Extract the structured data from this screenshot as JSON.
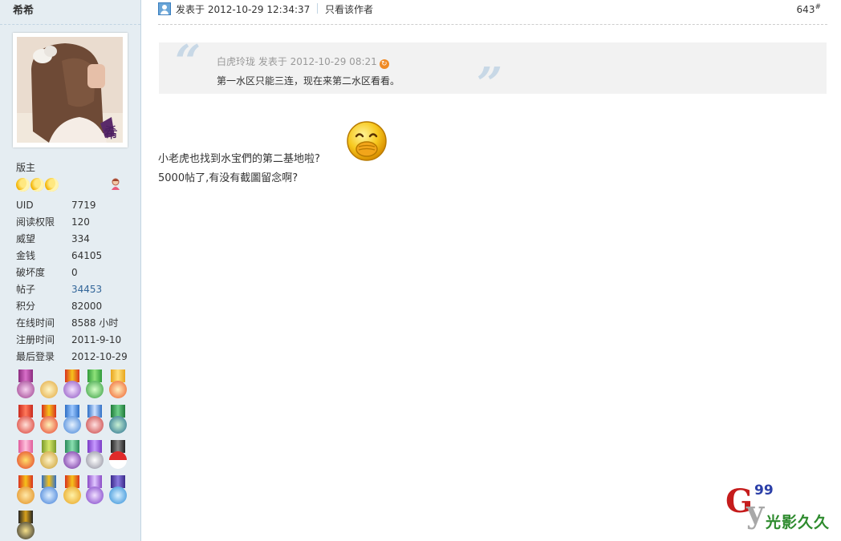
{
  "user": {
    "name": "希希",
    "group_title": "版主",
    "stats": [
      {
        "label": "UID",
        "value": "7719"
      },
      {
        "label": "阅读权限",
        "value": "120"
      },
      {
        "label": "威望",
        "value": "334"
      },
      {
        "label": "金钱",
        "value": "64105"
      },
      {
        "label": "破坏度",
        "value": "0"
      },
      {
        "label": "帖子",
        "value": "34453"
      },
      {
        "label": "积分",
        "value": "82000"
      },
      {
        "label": "在线时间",
        "value": "8588 小时"
      },
      {
        "label": "注册时间",
        "value": "2011-9-10"
      },
      {
        "label": "最后登录",
        "value": "2012-10-29"
      }
    ]
  },
  "post": {
    "posted_at": "发表于 2012-10-29 12:34:37",
    "only_author": "只看该作者",
    "floor": "643",
    "floor_mark": "#",
    "quote": {
      "meta": "白虎玲珑 发表于 2012-10-29 08:21",
      "text": "第一水区只能三连，现在来第二水区看看。"
    },
    "body_line1": "小老虎也找到水宝們的第二基地啦?",
    "body_line2": "5000帖了,有没有截圖留念啊?"
  },
  "watermark": {
    "letter_g": "G",
    "letter_y": "y",
    "number": "99",
    "text": "光影久久"
  },
  "colors": {
    "sidebar_bg": "#e5edf2",
    "link": "#336699",
    "quote_bg": "#f2f2f2"
  }
}
